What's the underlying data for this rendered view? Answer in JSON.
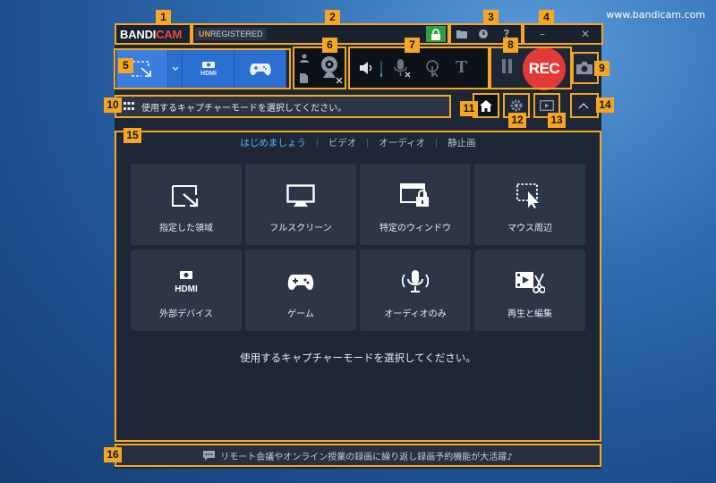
{
  "watermark": "www.bandicam.com",
  "titlebar": {
    "logo_white": "BANDI",
    "logo_red": "CAM",
    "reg_highlight": "UN",
    "reg_rest": "REGISTERED",
    "lock_icon": "lock-icon",
    "folder_icon": "folder-icon",
    "clock_icon": "clock-icon",
    "help_label": "?",
    "minimize_label": "–",
    "close_label": "✕"
  },
  "toolbar": {
    "modes": [
      "screen-area-mode",
      "hdmi-device-mode",
      "game-mode"
    ],
    "rec_label": "REC"
  },
  "hint_bar": {
    "text": "使用するキャプチャーモードを選択してください。"
  },
  "tabs": [
    {
      "label": "はじめましょう",
      "active": true
    },
    {
      "label": "ビデオ",
      "active": false
    },
    {
      "label": "オーディオ",
      "active": false
    },
    {
      "label": "静止画",
      "active": false
    }
  ],
  "tiles": [
    {
      "label": "指定した領域",
      "icon": "rectangle-area-icon"
    },
    {
      "label": "フルスクリーン",
      "icon": "monitor-icon"
    },
    {
      "label": "特定のウィンドウ",
      "icon": "window-lock-icon"
    },
    {
      "label": "マウス周辺",
      "icon": "mouse-cursor-area-icon"
    },
    {
      "label": "外部デバイス",
      "icon": "hdmi-device-icon"
    },
    {
      "label": "ゲーム",
      "icon": "gamepad-icon"
    },
    {
      "label": "オーディオのみ",
      "icon": "microphone-icon"
    },
    {
      "label": "再生と編集",
      "icon": "video-edit-icon"
    }
  ],
  "main_hint": "使用するキャプチャーモードを選択してください。",
  "footer": {
    "text": "リモート会議やオンライン授業の録画に繰り返し録画予約機能が大活躍♪"
  },
  "callouts": [
    "1",
    "2",
    "3",
    "4",
    "5",
    "6",
    "7",
    "8",
    "9",
    "10",
    "11",
    "12",
    "13",
    "14",
    "15",
    "16"
  ],
  "colors": {
    "accent_orange": "#f5a623",
    "rec_red": "#e23a3a",
    "mode_blue": "#2b6fd0",
    "tab_active": "#5fb2ff",
    "lock_green": "#2f9e44"
  }
}
